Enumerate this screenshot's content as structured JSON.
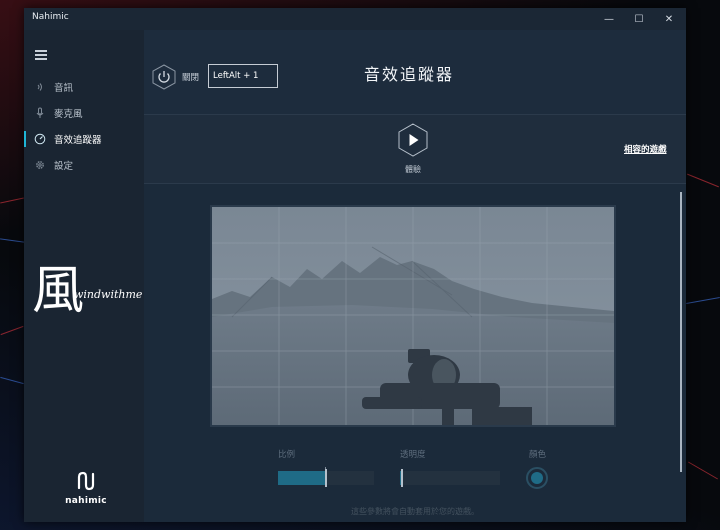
{
  "window": {
    "title": "Nahimic",
    "controls": {
      "minimize": "—",
      "maximize": "☐",
      "close": "✕"
    }
  },
  "sidebar": {
    "items": [
      {
        "label": "音訊",
        "icon": "sound-waves-icon"
      },
      {
        "label": "麥克風",
        "icon": "microphone-icon"
      },
      {
        "label": "音效追蹤器",
        "icon": "sound-tracker-icon",
        "active": true
      },
      {
        "label": "設定",
        "icon": "gear-icon"
      }
    ],
    "watermark": {
      "glyph": "風",
      "text": "windwithme"
    },
    "logo_text": "nahimic"
  },
  "header": {
    "power_label": "關閉",
    "hotkey_value": "LeftAlt + 1",
    "page_title": "音效追蹤器"
  },
  "toolbar": {
    "play_label": "體驗",
    "compat_link": "相容的遊戲"
  },
  "controls": {
    "scale_label": "比例",
    "scale_value": 0.5,
    "opacity_label": "透明度",
    "opacity_value": 0.02,
    "color_label": "顏色",
    "color_value": "#1f6b86"
  },
  "footnote": "這些參數將會自動套用於您的遊戲。",
  "colors": {
    "accent": "#1fb5d6",
    "window_bg": "#16212e"
  }
}
